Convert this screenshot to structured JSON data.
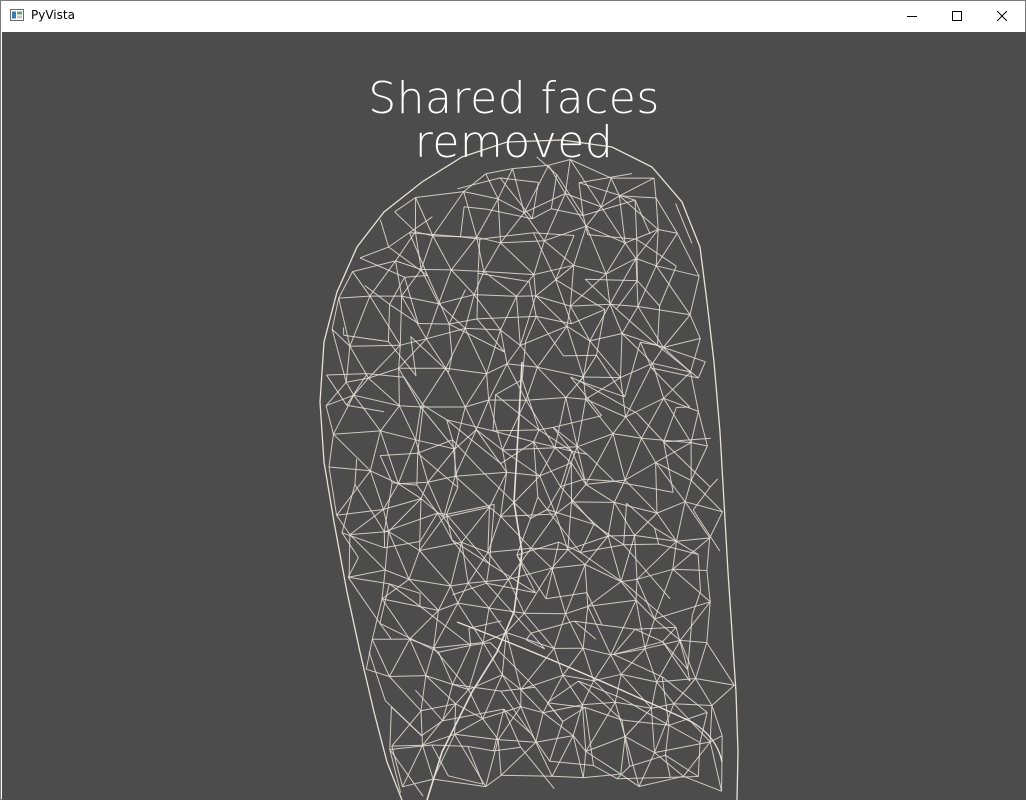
{
  "window": {
    "title": "PyVista",
    "icon": "pyvista-app-icon",
    "controls": [
      "minimize-icon",
      "maximize-icon",
      "close-icon"
    ]
  },
  "viewport": {
    "background_color": "#4c4c4c",
    "mesh_color": "#e6e2d8",
    "render_style": "wireframe",
    "title_lines": [
      "Shared faces",
      "removed"
    ]
  }
}
